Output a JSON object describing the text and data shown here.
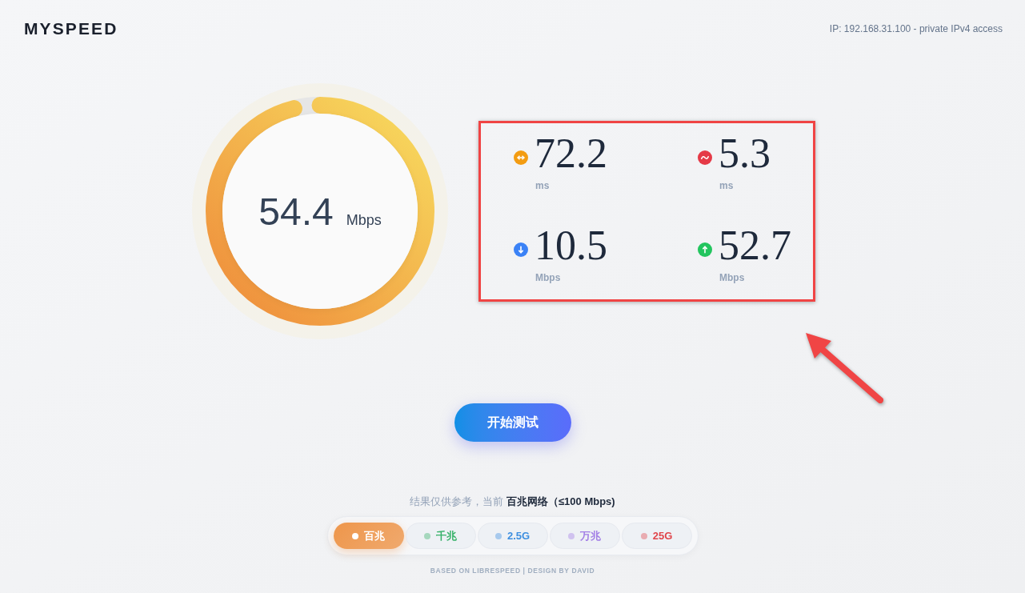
{
  "header": {
    "logo": "MYSPEED",
    "ip_info": "IP: 192.168.31.100 - private IPv4 access"
  },
  "gauge": {
    "value": "54.4",
    "unit": "Mbps",
    "level": 0.96
  },
  "metrics": [
    {
      "kind": "ping",
      "value": "72.2",
      "unit": "ms",
      "color": "#f39c12"
    },
    {
      "kind": "jitter",
      "value": "5.3",
      "unit": "ms",
      "color": "#e53946"
    },
    {
      "kind": "download",
      "value": "10.5",
      "unit": "Mbps",
      "color": "#3b82f6"
    },
    {
      "kind": "upload",
      "value": "52.7",
      "unit": "Mbps",
      "color": "#22c55e"
    }
  ],
  "start_button": {
    "label": "开始测试"
  },
  "note": "结果仅供参考，当前 **百兆网络（≤100 Mbps)**",
  "tiers": [
    {
      "label": "百兆",
      "selected": true,
      "color": "#ee964b"
    },
    {
      "label": "千兆",
      "selected": false,
      "color": "#38b26a"
    },
    {
      "label": "2.5G",
      "selected": false,
      "color": "#3d8fe0"
    },
    {
      "label": "万兆",
      "selected": false,
      "color": "#a27ee6"
    },
    {
      "label": "25G",
      "selected": false,
      "color": "#e0454a"
    }
  ],
  "footer": "BASED ON LIBRESPEED | DESIGN BY DAVID"
}
